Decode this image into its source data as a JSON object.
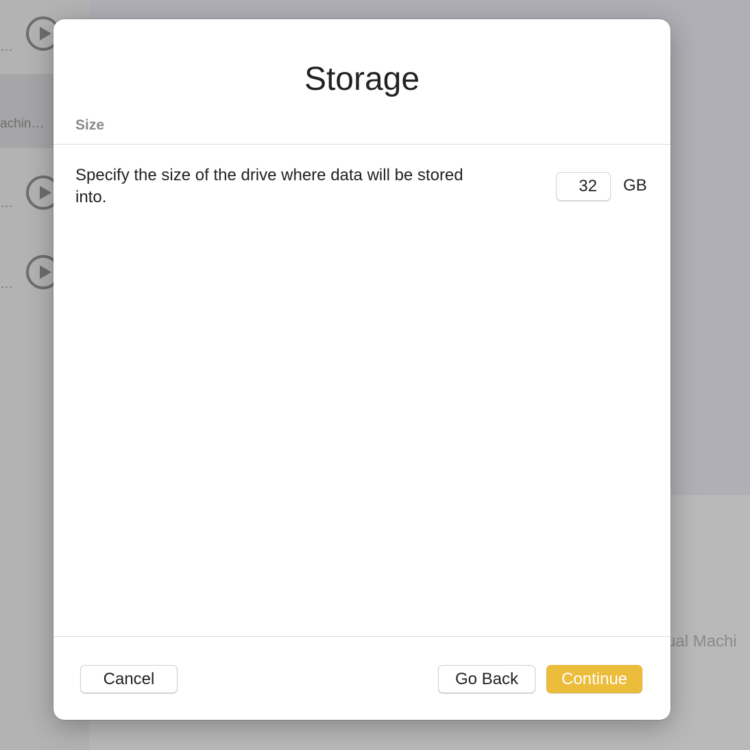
{
  "background": {
    "sidebar_items": [
      {
        "label": "…",
        "selected": false
      },
      {
        "label": "achin…",
        "selected": true
      },
      {
        "label": "…",
        "selected": false
      },
      {
        "label": "…",
        "selected": false
      }
    ],
    "main_partial_text": "ual Machi"
  },
  "dialog": {
    "title": "Storage",
    "section_header": "Size",
    "size_description": "Specify the size of the drive where data will be stored into.",
    "size_value": "32",
    "size_unit": "GB",
    "buttons": {
      "cancel": "Cancel",
      "go_back": "Go Back",
      "continue": "Continue"
    }
  },
  "colors": {
    "accent": "#ecbc3b"
  }
}
